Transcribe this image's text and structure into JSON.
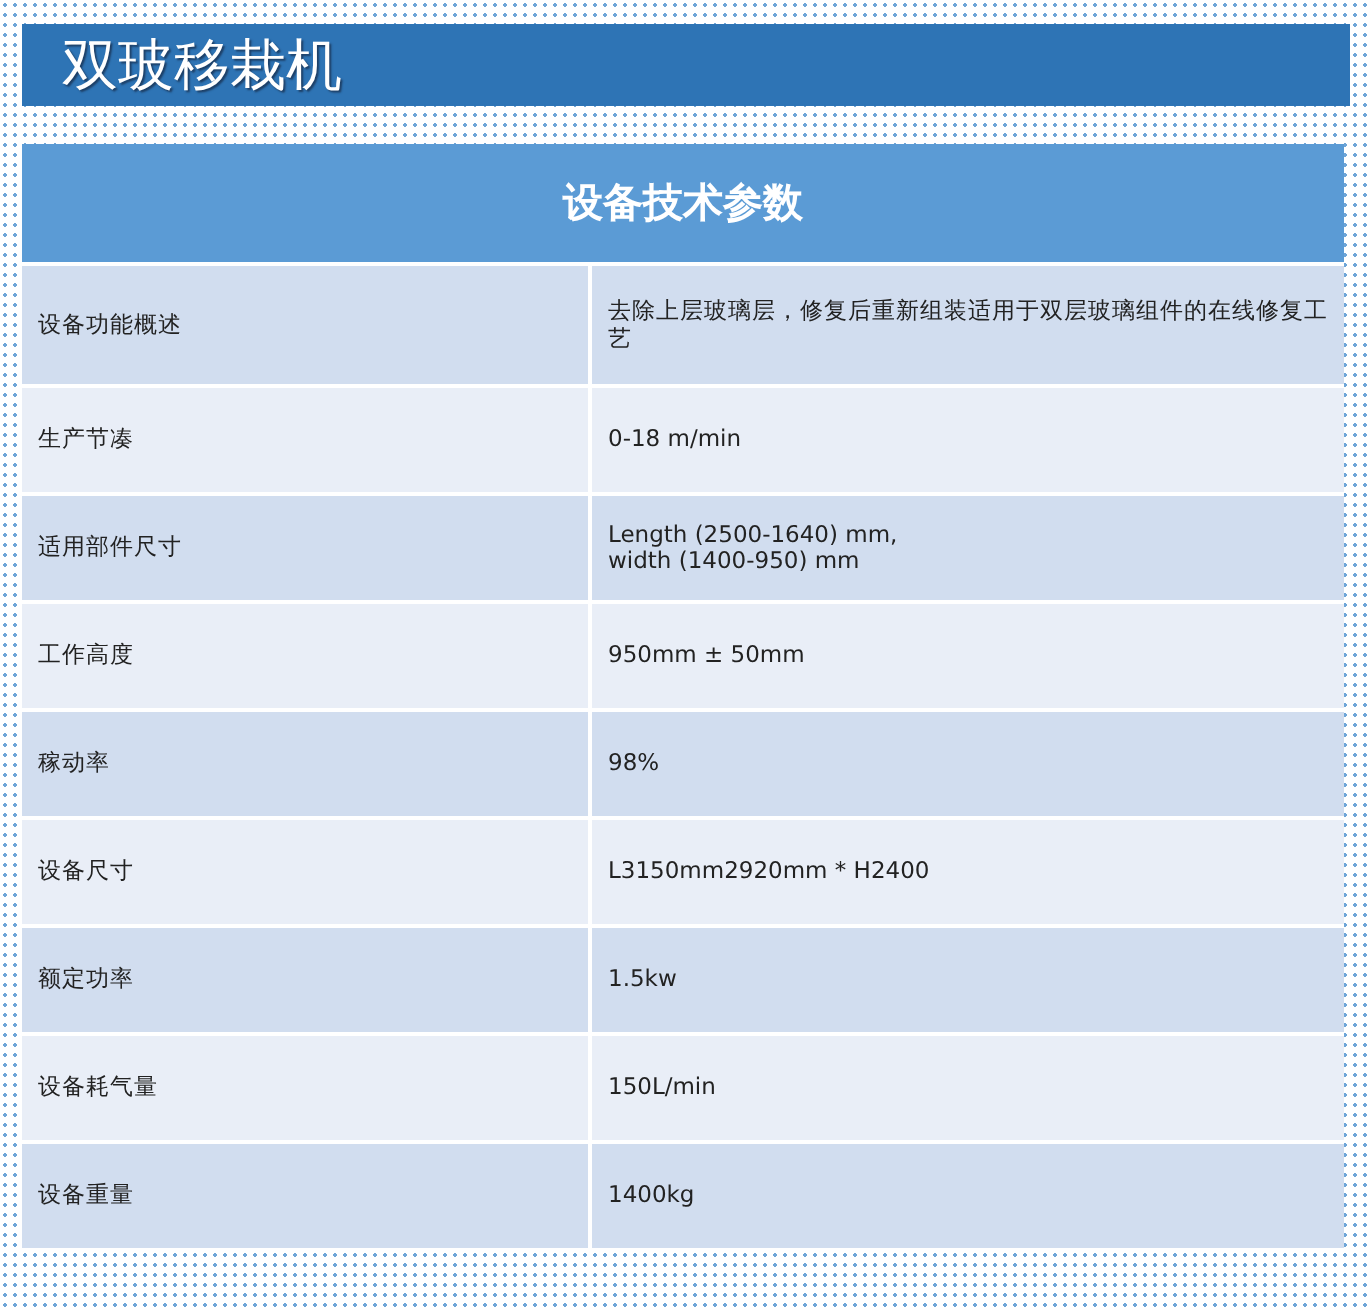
{
  "title": "双玻移栽机",
  "table": {
    "caption": "设备技术参数",
    "rows": [
      {
        "label": "设备功能概述",
        "value": "去除上层玻璃层，修复后重新组装适用于双层玻璃组件的在线修复工艺"
      },
      {
        "label": "生产节凑",
        "value": "0-18 m/min"
      },
      {
        "label": "适用部件尺寸",
        "value": "Length (2500-1640) mm,\nwidth (1400-950) mm"
      },
      {
        "label": "工作高度",
        "value": "950mm ± 50mm"
      },
      {
        "label": "稼动率",
        "value": "98%"
      },
      {
        "label": "设备尺寸",
        "value": "L3150mm2920mm * H2400"
      },
      {
        "label": "额定功率",
        "value": "1.5kw"
      },
      {
        "label": "设备耗气量",
        "value": "150L/min"
      },
      {
        "label": "设备重量",
        "value": "1400kg"
      }
    ]
  }
}
